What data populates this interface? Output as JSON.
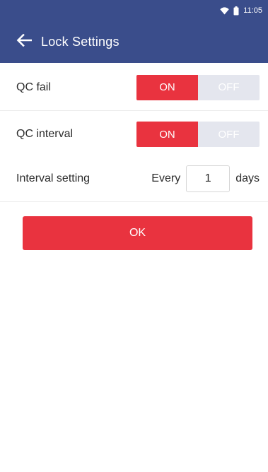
{
  "status_bar": {
    "time": "11:05",
    "icons": [
      "wifi-icon",
      "battery-icon"
    ]
  },
  "header": {
    "title": "Lock Settings",
    "back_icon": "arrow-left-icon"
  },
  "settings": {
    "qc_fail": {
      "label": "QC fail",
      "on_label": "ON",
      "off_label": "OFF",
      "value": "ON"
    },
    "qc_interval": {
      "label": "QC interval",
      "on_label": "ON",
      "off_label": "OFF",
      "value": "ON"
    },
    "interval_setting": {
      "label": "Interval setting",
      "prefix": "Every",
      "value": "1",
      "suffix": "days"
    }
  },
  "actions": {
    "ok_label": "OK"
  },
  "colors": {
    "header": "#3a4d8b",
    "accent": "#e9333f",
    "toggle_off_bg": "#e4e6ee"
  }
}
